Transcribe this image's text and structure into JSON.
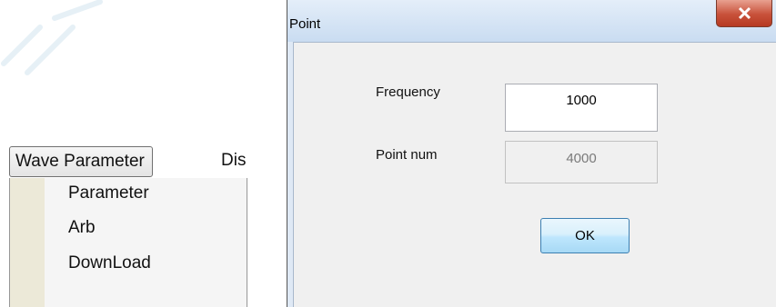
{
  "menu": {
    "bar_items": [
      "Wave Parameter",
      "Dis"
    ],
    "dropdown_items": [
      "Parameter",
      "Arb",
      "DownLoad"
    ]
  },
  "dialog": {
    "title": "Point",
    "frequency_label": "Frequency",
    "frequency_value": "1000",
    "point_num_label": "Point num",
    "point_num_value": "4000",
    "ok_label": "OK"
  },
  "icons": {
    "close": "close-icon"
  },
  "colors": {
    "menu_gutter": "#ece9d8",
    "close_button": "#c8513a",
    "ok_button": "#bee6fd",
    "dialog_frame": "#dfe9f5"
  }
}
